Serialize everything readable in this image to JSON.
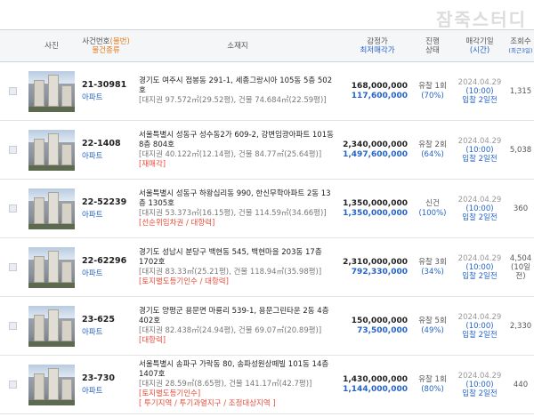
{
  "watermark": "잠죽스터디",
  "header": {
    "photo": "사진",
    "case_no": "사건번호",
    "status_suffix": "(물번)",
    "kind": "물건종류",
    "address": "소재지",
    "appraise": "감정가",
    "minimum": "최저매각가",
    "progress": "진행",
    "state": "상태",
    "sale_date": "매각기일",
    "time": "(시간)",
    "views": "조회수",
    "views_sub": "(최근3일)"
  },
  "rows": [
    {
      "case_no": "21-30981",
      "kind": "아파트",
      "address": "경기도 여주시 점봉동 291-1, 세종그랑시아 105동 5층 502호",
      "detail": "[대지권 97.572㎡(29.52평), 건물 74.684㎡(22.59평)]",
      "tags": "",
      "appraise": "168,000,000",
      "minimum": "117,600,000",
      "status": "유찰 1회",
      "pct": "(70%)",
      "date": "2024.04.29",
      "time": "(10:00)",
      "dday": "입찰 2일전",
      "views": "1,315",
      "views_sub": ""
    },
    {
      "case_no": "22-1408",
      "kind": "아파트",
      "address": "서울특별시 성동구 성수동2가 609-2, 강변임광아파트 101동 8층 804호",
      "detail": "[대지권 40.122㎡(12.14평), 건물 84.77㎡(25.64평)]",
      "tags": "[재매각]",
      "appraise": "2,340,000,000",
      "minimum": "1,497,600,000",
      "status": "유찰 2회",
      "pct": "(64%)",
      "date": "2024.04.29",
      "time": "(10:00)",
      "dday": "입찰 2일전",
      "views": "5,038",
      "views_sub": ""
    },
    {
      "case_no": "22-52239",
      "kind": "아파트",
      "address": "서울특별시 성동구 하왕십리동 990, 한신무학아파트 2동 13층 1305호",
      "detail": "[대지권 53.373㎡(16.15평), 건물 114.59㎡(34.66평)]",
      "tags": "[선순위임차권 / 대항력]",
      "appraise": "1,350,000,000",
      "minimum": "1,350,000,000",
      "status": "신건",
      "pct": "(100%)",
      "date": "2024.04.29",
      "time": "(10:00)",
      "dday": "입찰 2일전",
      "views": "360",
      "views_sub": ""
    },
    {
      "case_no": "22-62296",
      "kind": "아파트",
      "address": "경기도 성남시 분당구 백현동 545, 백현마을 203동 17층 1702호",
      "detail": "[대지권 83.33㎡(25.21평), 건물 118.94㎡(35.98평)]",
      "tags": "[토지별도등기인수 / 대항력]",
      "appraise": "2,310,000,000",
      "minimum": "792,330,000",
      "status": "유찰 3회",
      "pct": "(34%)",
      "date": "2024.04.29",
      "time": "(10:00)",
      "dday": "입찰 2일전",
      "views": "4,504",
      "views_sub": "(10일전)"
    },
    {
      "case_no": "23-625",
      "kind": "아파트",
      "address": "경기도 양평군 용문면 마룡리 539-1, 용문그린타운 2동 4층 402호",
      "detail": "[대지권 82.438㎡(24.94평), 건물 69.07㎡(20.89평)]",
      "tags": "[대항력]",
      "appraise": "150,000,000",
      "minimum": "73,500,000",
      "status": "유찰 5회",
      "pct": "(49%)",
      "date": "2024.04.29",
      "time": "(10:00)",
      "dday": "입찰 2일전",
      "views": "2,330",
      "views_sub": ""
    },
    {
      "case_no": "23-730",
      "kind": "아파트",
      "address": "서울특별시 송파구 가락동 80, 송파성원상떼빌 101동 14층 1407호",
      "detail": "[대지권 28.59㎡(8.65평), 건물 141.17㎡(42.7평)]",
      "tags": "[토지별도등기인수]",
      "tags2": "[ 투기지역 / 투기과열지구 / 조정대상지역 ]",
      "appraise": "1,430,000,000",
      "minimum": "1,144,000,000",
      "status": "유찰 1회",
      "pct": "(80%)",
      "date": "2024.04.29",
      "time": "(10:00)",
      "dday": "입찰 2일전",
      "views": "440",
      "views_sub": ""
    }
  ]
}
